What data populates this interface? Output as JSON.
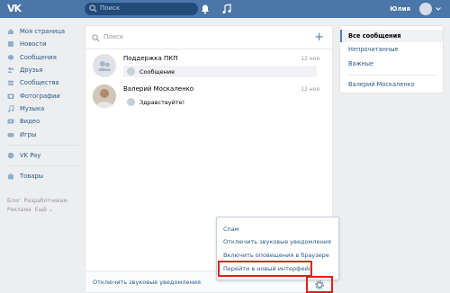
{
  "header": {
    "logo": "VK",
    "search_placeholder": "Поиск",
    "user_name": "Юлия"
  },
  "nav": {
    "items": [
      {
        "label": "Моя страница",
        "icon": "home-icon"
      },
      {
        "label": "Новости",
        "icon": "news-icon"
      },
      {
        "label": "Сообщения",
        "icon": "messages-icon"
      },
      {
        "label": "Друзья",
        "icon": "friends-icon"
      },
      {
        "label": "Сообщества",
        "icon": "communities-icon"
      },
      {
        "label": "Фотографии",
        "icon": "photos-icon"
      },
      {
        "label": "Музыка",
        "icon": "music-icon"
      },
      {
        "label": "Видео",
        "icon": "video-icon"
      },
      {
        "label": "Игры",
        "icon": "games-icon"
      }
    ],
    "vkpay": "VK Pay",
    "goods": "Товары",
    "footer_links": [
      "Блог",
      "Разработчикам",
      "Реклама",
      "Ещё ⌄"
    ]
  },
  "main": {
    "search_placeholder": "Поиск",
    "dialogs": [
      {
        "name": "Поддержка ПКП",
        "date": "12 ноя",
        "preview": "Сообщение"
      },
      {
        "name": "Валерий Москаленко",
        "date": "12 ноя",
        "preview": "Здравствуйте!"
      }
    ],
    "footer_link": "Отключить звуковые уведомления"
  },
  "menu": {
    "items": [
      "Спам",
      "Отключить звуковые уведомления",
      "Включить оповещения в браузере",
      "Перейти в новый интерфейс"
    ]
  },
  "right": {
    "items": [
      "Все сообщения",
      "Непрочитанные",
      "Важные"
    ],
    "contact": "Валерий Москаленко"
  },
  "colors": {
    "header": "#4a76a8",
    "link": "#2a5885",
    "highlight": "#e0201f",
    "background": "#edeef0"
  }
}
